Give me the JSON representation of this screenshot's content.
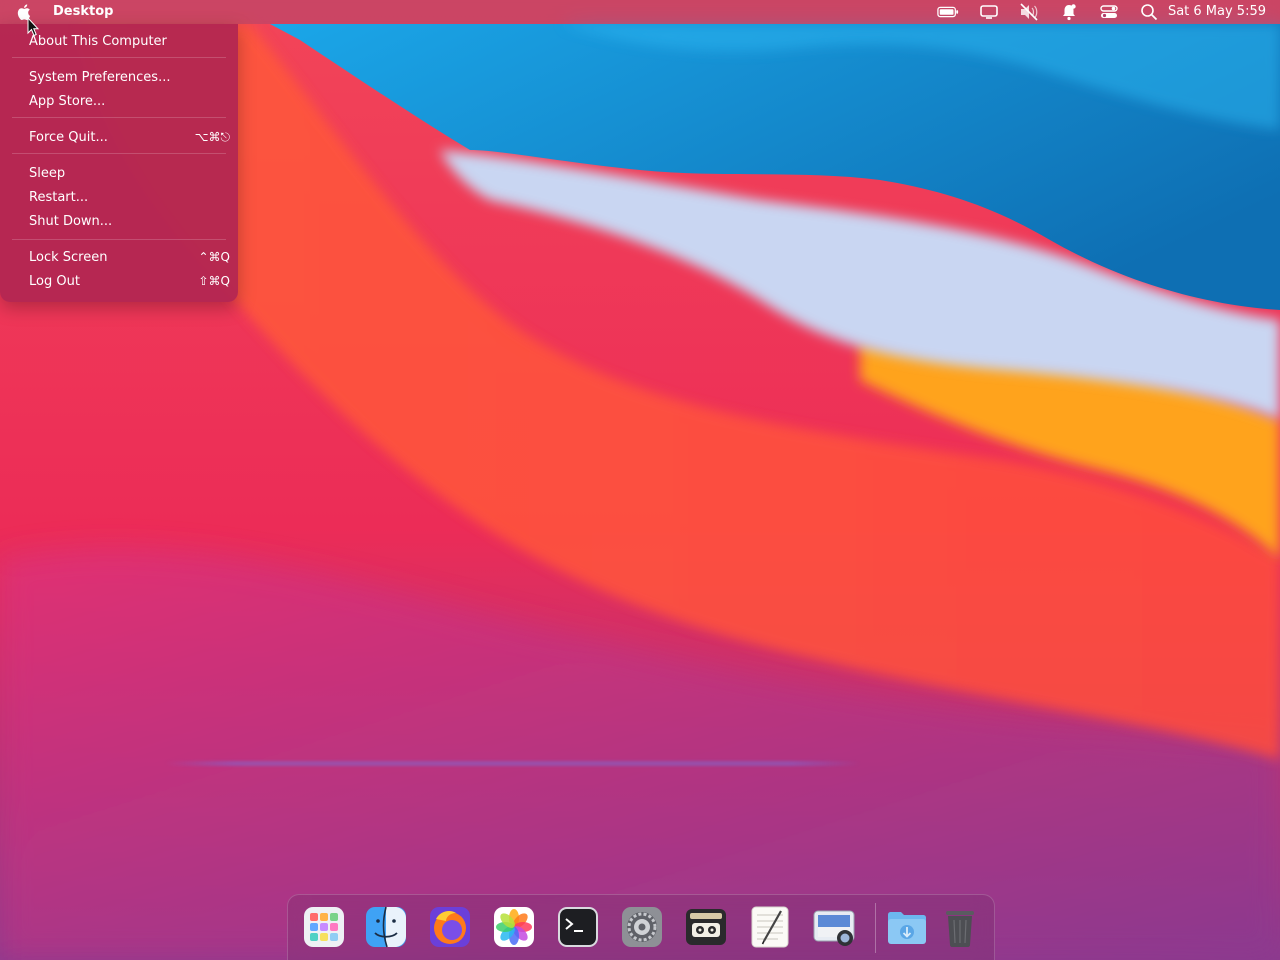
{
  "menubar": {
    "app_title": "Desktop",
    "clock": "Sat 6 May  5:59",
    "status_icons": [
      "battery-icon",
      "display-icon",
      "muted-speaker-icon",
      "notification-bell-icon",
      "control-center-icon",
      "search-icon"
    ]
  },
  "apple_menu": {
    "items": [
      {
        "label": "About This Computer",
        "shortcut": ""
      },
      {
        "label": "System Preferences...",
        "shortcut": ""
      },
      {
        "label": "App Store...",
        "shortcut": ""
      },
      {
        "label": "Force Quit...",
        "shortcut": "⌥⌘⎋"
      },
      {
        "label": "Sleep",
        "shortcut": ""
      },
      {
        "label": "Restart...",
        "shortcut": ""
      },
      {
        "label": "Shut Down...",
        "shortcut": ""
      },
      {
        "label": "Lock Screen",
        "shortcut": "⌃⌘Q"
      },
      {
        "label": "Log Out",
        "shortcut": "⇧⌘Q"
      }
    ]
  },
  "dock": {
    "apps": [
      "launchpad-icon",
      "finder-icon",
      "firefox-icon",
      "photos-icon",
      "terminal-icon",
      "system-preferences-icon",
      "tape-recorder-icon",
      "text-editor-icon",
      "screenshot-icon",
      "downloads-folder-icon",
      "trash-icon"
    ]
  },
  "colors": {
    "menu_background": "#b22652",
    "menubar_background": "#8c4678",
    "wallpaper_blue": "#1a8fd6",
    "wallpaper_red": "#f0304e",
    "wallpaper_orange": "#ff8a2a",
    "wallpaper_purple": "#8b3a8f"
  }
}
